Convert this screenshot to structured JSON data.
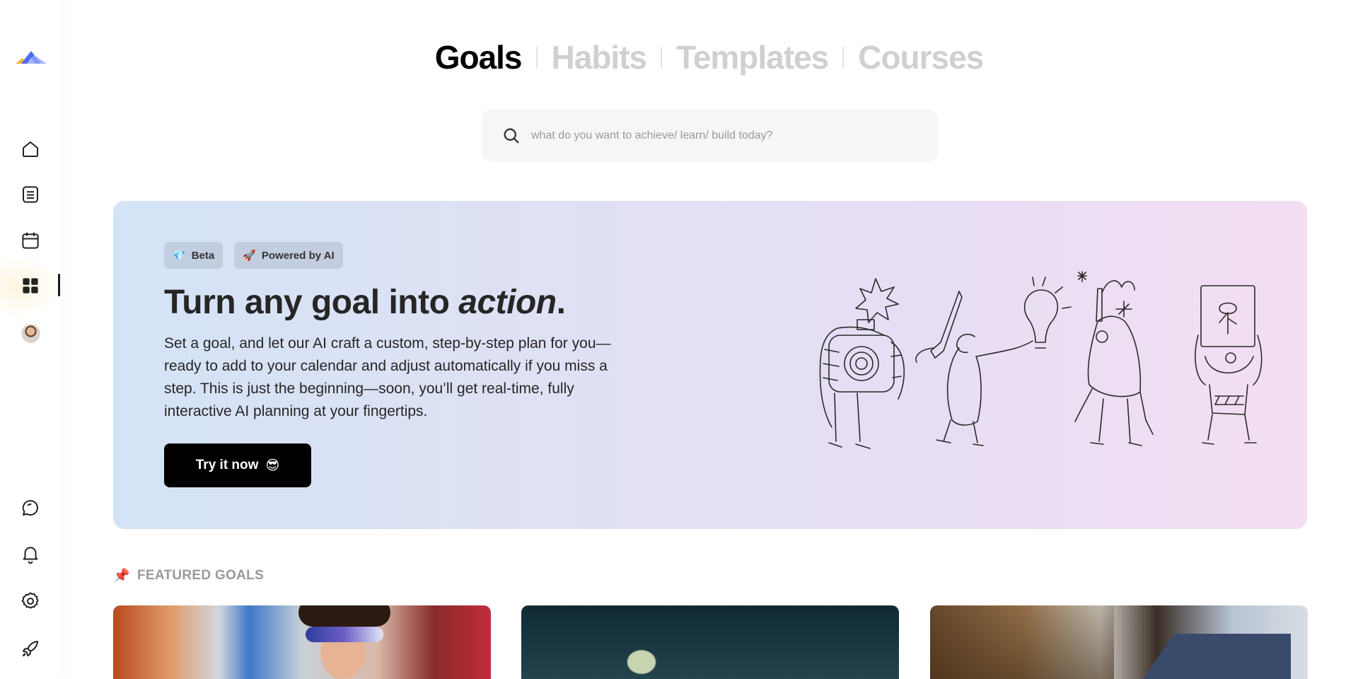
{
  "tabs": [
    {
      "label": "Goals",
      "active": true
    },
    {
      "label": "Habits",
      "active": false
    },
    {
      "label": "Templates",
      "active": false
    },
    {
      "label": "Courses",
      "active": false
    }
  ],
  "search": {
    "placeholder": "what do you want to achieve/ learn/ build today?",
    "value": ""
  },
  "sidebar": {
    "top_items": [
      {
        "name": "home",
        "icon": "home-icon"
      },
      {
        "name": "notes",
        "icon": "document-list-icon"
      },
      {
        "name": "calendar",
        "icon": "calendar-icon"
      },
      {
        "name": "dashboard",
        "icon": "grid-icon",
        "active": true
      },
      {
        "name": "profile",
        "icon": "avatar"
      }
    ],
    "bottom_items": [
      {
        "name": "chat",
        "icon": "chat-bubble-icon"
      },
      {
        "name": "notifications",
        "icon": "bell-icon"
      },
      {
        "name": "settings",
        "icon": "gear-icon"
      },
      {
        "name": "launch",
        "icon": "rocket-icon"
      }
    ]
  },
  "hero": {
    "badges": [
      {
        "emoji": "💎",
        "label": "Beta"
      },
      {
        "emoji": "🚀",
        "label": "Powered by AI"
      }
    ],
    "title_prefix": "Turn any goal into ",
    "title_emphasis": "action",
    "title_suffix": ".",
    "description": "Set a goal, and let our AI craft a custom, step-by-step plan for you—ready to add to your calendar and adjust automatically if you miss a step. This is just the beginning—soon, you’ll get real-time, fully interactive AI planning at your fingertips.",
    "cta_label": "Try it now",
    "cta_emoji": "😎"
  },
  "featured": {
    "emoji": "📌",
    "label": "FEATURED GOALS"
  },
  "colors": {
    "accent_dark": "#000000",
    "hero_gradient_start": "#d4e3f6",
    "hero_gradient_end": "#f3def2",
    "logo_blue": "#4f6bf0",
    "logo_orange": "#f5b23a"
  }
}
